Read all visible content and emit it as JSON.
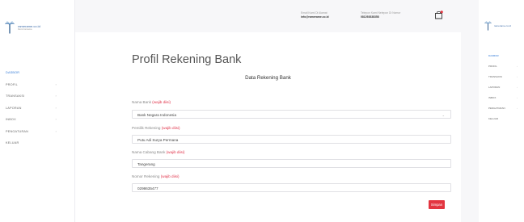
{
  "brand": {
    "name": "ramerame.co.id",
    "tagline": "bisnis bersama"
  },
  "sidebar": {
    "items": [
      {
        "label": "DASBOR",
        "active": true,
        "has_submenu": false
      },
      {
        "label": "PROFIL",
        "active": false,
        "has_submenu": true
      },
      {
        "label": "TRANSAKSI",
        "active": false,
        "has_submenu": true
      },
      {
        "label": "LAPORAN",
        "active": false,
        "has_submenu": true
      },
      {
        "label": "INBOX",
        "active": false,
        "has_submenu": true
      },
      {
        "label": "PENGATURAN",
        "active": false,
        "has_submenu": true
      },
      {
        "label": "KELUAR",
        "active": false,
        "has_submenu": false
      }
    ]
  },
  "header": {
    "email_label": "Email Kami Di Alamat",
    "email_value": "info@ramerame.co.id",
    "phone_label": "Telepon Kami Nelepon Di Nomor",
    "phone_value": "081293838358"
  },
  "main": {
    "page_title": "Profil Rekening Bank",
    "section_title": "Data Rekening Bank",
    "required_text": "(wajib diisi)",
    "fields": {
      "bank_name": {
        "label": "Nama Bank",
        "value": "Bank Negara Indonesia"
      },
      "owner": {
        "label": "Pemilik Rekening",
        "value": "Putu Adi Surya Permana"
      },
      "branch": {
        "label": "Nama Cabang Bank",
        "value": "Tangerang"
      },
      "account_number": {
        "label": "Nomor Rekening",
        "value": "0298635477"
      }
    },
    "submit_label": "Simpan"
  },
  "colors": {
    "accent": "#2f78d6",
    "danger": "#e33540",
    "required": "#e0334a"
  }
}
